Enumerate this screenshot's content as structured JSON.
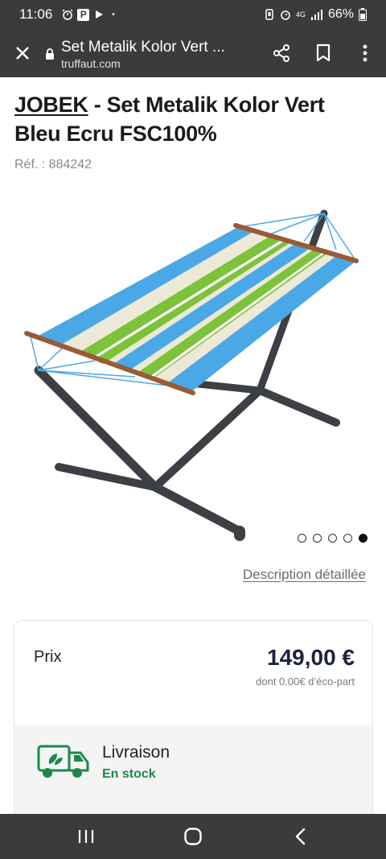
{
  "status_bar": {
    "time": "11:06",
    "p_badge": "P",
    "dot": "•",
    "network": "4G",
    "battery": "66%"
  },
  "browser": {
    "page_title": "Set Metalik Kolor Vert ...",
    "domain": "truffaut.com"
  },
  "product": {
    "brand": "JOBEK",
    "title_rest": " - Set Metalik Kolor Vert Bleu Ecru FSC100%",
    "reference": "Réf. : 884242"
  },
  "gallery": {
    "total_images": 5,
    "active_index": 4,
    "colors": {
      "stand": "#3c3f44",
      "blue": "#4aa8e6",
      "green": "#7cc23a",
      "ecru": "#ece9d6",
      "wood": "#9a5a36"
    }
  },
  "description_link": "Description détaillée",
  "pricing": {
    "label": "Prix",
    "price": "149,00 €",
    "eco_part": "dont 0.00€ d’éco-part"
  },
  "delivery": {
    "title": "Livraison",
    "status": "En stock",
    "status_color": "#1a8a4b"
  },
  "nav": {
    "recent_icon": "recent-apps-icon",
    "home_icon": "home-icon",
    "back_icon": "back-icon"
  }
}
